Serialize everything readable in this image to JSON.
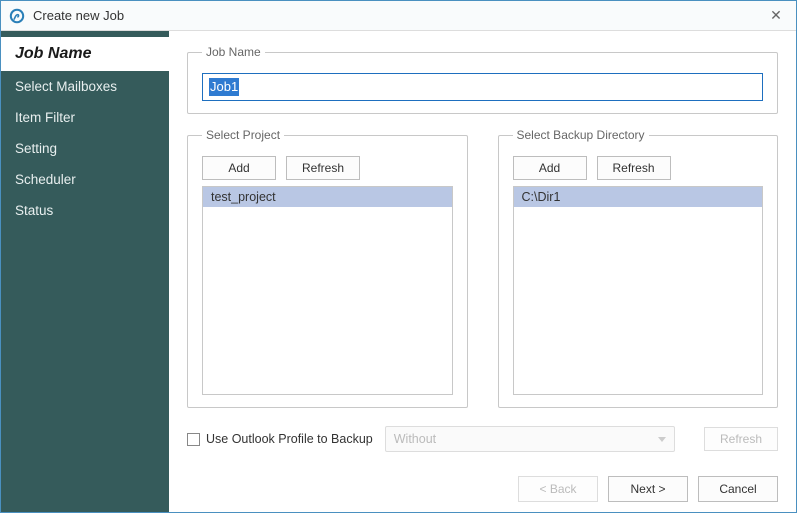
{
  "window": {
    "title": "Create new Job"
  },
  "sidebar": {
    "items": [
      {
        "label": "Job Name",
        "active": true
      },
      {
        "label": "Select Mailboxes"
      },
      {
        "label": "Item Filter"
      },
      {
        "label": "Setting"
      },
      {
        "label": "Scheduler"
      },
      {
        "label": "Status"
      }
    ]
  },
  "jobname": {
    "legend": "Job Name",
    "value": "Job1"
  },
  "project": {
    "legend": "Select Project",
    "add_label": "Add",
    "refresh_label": "Refresh",
    "items": [
      "test_project"
    ]
  },
  "backupdir": {
    "legend": "Select Backup Directory",
    "add_label": "Add",
    "refresh_label": "Refresh",
    "items": [
      "C:\\Dir1"
    ]
  },
  "outlook": {
    "checkbox_label": "Use Outlook Profile to Backup",
    "checked": false,
    "combo_value": "Without",
    "refresh_label": "Refresh",
    "enabled": false
  },
  "footer": {
    "back_label": "< Back",
    "next_label": "Next >",
    "cancel_label": "Cancel",
    "back_enabled": false
  }
}
